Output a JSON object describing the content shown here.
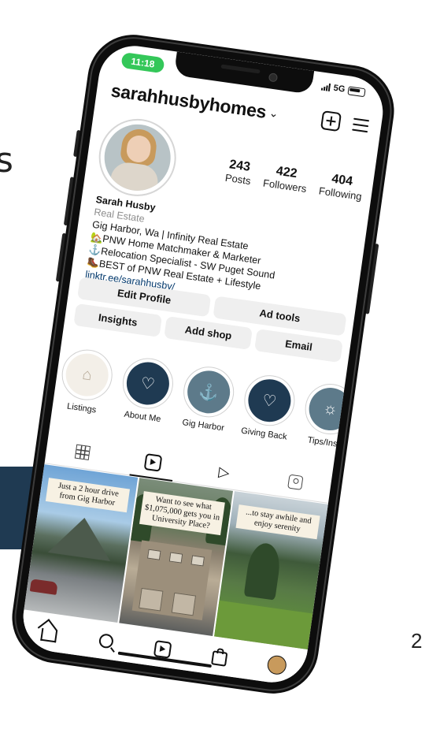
{
  "page": {
    "edge_letter": "s",
    "page_number": "2"
  },
  "status_bar": {
    "time": "11:18",
    "network": "5G"
  },
  "header": {
    "username": "sarahhusbyhomes"
  },
  "profile": {
    "stats": [
      {
        "value": "243",
        "label": "Posts"
      },
      {
        "value": "422",
        "label": "Followers"
      },
      {
        "value": "404",
        "label": "Following"
      }
    ],
    "name": "Sarah Husby",
    "category": "Real Estate",
    "bio_lines": [
      "Gig Harbor, Wa | Infinity Real Estate",
      "🏡PNW Home Matchmaker & Marketer",
      "⚓Relocation Specialist - SW Puget Sound",
      "🥾BEST of PNW Real Estate + Lifestyle"
    ],
    "link": "linktr.ee/sarahhusby/"
  },
  "buttons": {
    "edit_profile": "Edit Profile",
    "ad_tools": "Ad tools",
    "insights": "Insights",
    "add_shop": "Add shop",
    "email": "Email"
  },
  "highlights": [
    {
      "label": "Listings",
      "icon": "house-icon"
    },
    {
      "label": "About Me",
      "icon": "hearts-icon"
    },
    {
      "label": "Gig Harbor",
      "icon": "anchor-icon"
    },
    {
      "label": "Giving Back",
      "icon": "gift-bag-icon"
    },
    {
      "label": "Tips/Insp",
      "icon": "lightbulb-icon"
    }
  ],
  "posts": [
    {
      "caption": "Just a 2 hour drive from Gig Harbor"
    },
    {
      "caption": "Want to see what $1,075,000 gets you in University Place?"
    },
    {
      "caption": "...to stay awhile and enjoy serenity"
    }
  ],
  "colors": {
    "accent_green": "#34c759",
    "highlight_navy": "#1f3a52",
    "highlight_slate": "#5d7a8a",
    "link_blue": "#00376b"
  }
}
